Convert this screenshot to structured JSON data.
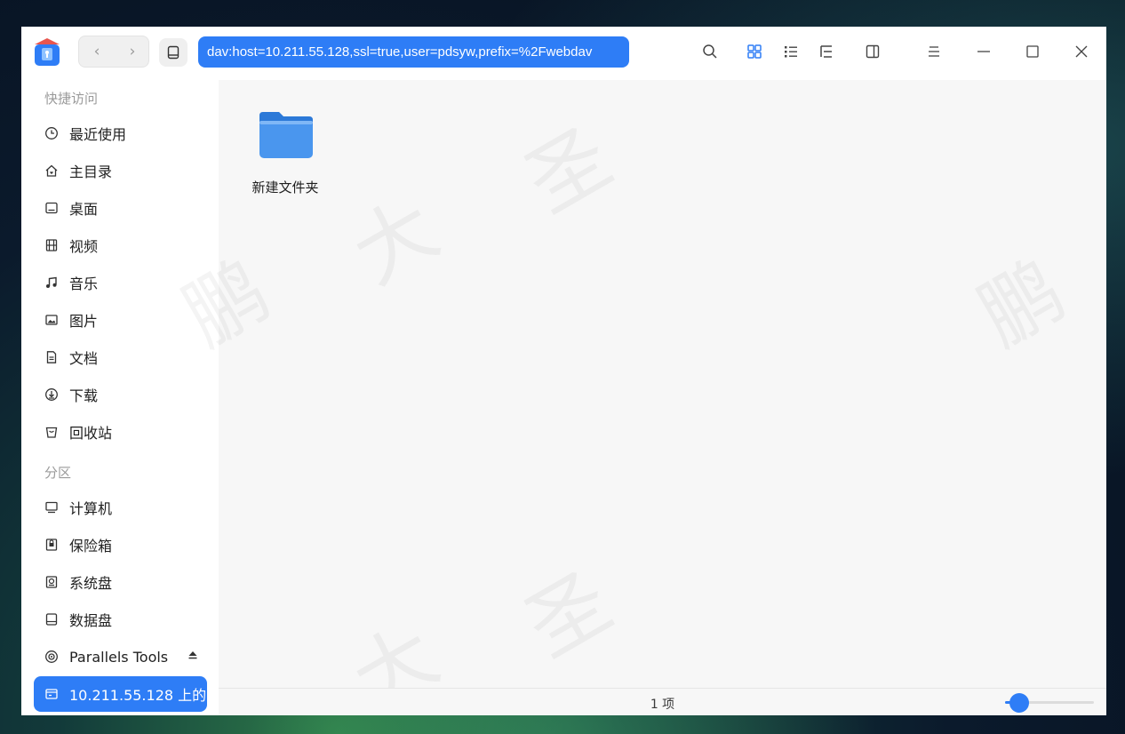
{
  "titlebar": {
    "address": "dav:host=10.211.55.128,ssl=true,user=pdsyw,prefix=%2Fwebdav",
    "back_label": "‹",
    "forward_label": "›"
  },
  "sidebar": {
    "quick_access_title": "快捷访问",
    "quick_items": [
      {
        "label": "最近使用",
        "icon": "clock-icon"
      },
      {
        "label": "主目录",
        "icon": "home-icon"
      },
      {
        "label": "桌面",
        "icon": "desktop-icon"
      },
      {
        "label": "视频",
        "icon": "film-icon"
      },
      {
        "label": "音乐",
        "icon": "music-icon"
      },
      {
        "label": "图片",
        "icon": "image-icon"
      },
      {
        "label": "文档",
        "icon": "document-icon"
      },
      {
        "label": "下载",
        "icon": "download-icon"
      },
      {
        "label": "回收站",
        "icon": "trash-icon"
      }
    ],
    "partition_title": "分区",
    "partition_items": [
      {
        "label": "计算机",
        "icon": "computer-icon"
      },
      {
        "label": "保险箱",
        "icon": "vault-icon"
      },
      {
        "label": "系统盘",
        "icon": "system-disk-icon"
      },
      {
        "label": "数据盘",
        "icon": "data-disk-icon"
      },
      {
        "label": "Parallels Tools",
        "icon": "disc-icon"
      },
      {
        "label": "10.211.55.128 上的…",
        "icon": "network-drive-icon"
      }
    ]
  },
  "main": {
    "files": [
      {
        "name": "新建文件夹",
        "icon": "folder-icon"
      }
    ],
    "watermark_chars": [
      "鹏",
      "大",
      "圣"
    ]
  },
  "status": {
    "item_count": "1 项",
    "icon_zoom_fraction": 0.16
  },
  "colors": {
    "accent": "#2e7df6",
    "folder": "#3f8ee8"
  }
}
